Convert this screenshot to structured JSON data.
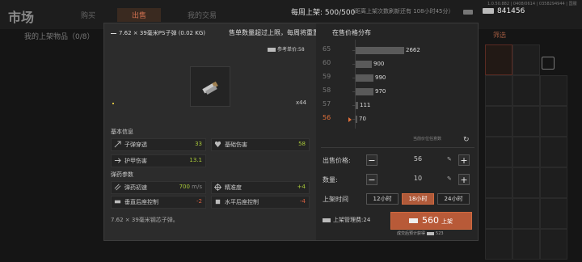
{
  "background": {
    "title": "市场",
    "tabs": [
      "购买",
      "出售",
      "我的交易"
    ],
    "listing_limit_label": "每周上架:",
    "listing_limit_value": "500/500",
    "listing_limit_note": "（距离上架次数刷新还有 108小时45分）",
    "debug_text": "1.0.50.882 | 0408/0614 | 0358294944 | 国服",
    "money": "841456",
    "my_listings": "我的上架物品（0/8）",
    "right_button": "筛选"
  },
  "item": {
    "name": "7.62 × 39毫米PS子弹 (0.02 KG)",
    "reference_label": "参考单价:",
    "reference_price": "58",
    "quantity": "x44",
    "description": "7.62 × 39毫米钢芯子弹。"
  },
  "warning": "售单数量超过上限，每周将重置售单上限",
  "basic_info_title": "基本信息",
  "basic_stats": [
    {
      "label": "子弹穿透",
      "value": "33",
      "icon": "penetration-icon"
    },
    {
      "label": "基础伤害",
      "value": "58",
      "icon": "damage-icon"
    },
    {
      "label": "护甲伤害",
      "value": "13.1",
      "icon": "armor-damage-icon"
    }
  ],
  "ammo_params_title": "弹药参数",
  "ammo_stats": [
    {
      "label": "弹药初速",
      "value": "700",
      "unit": "m/s",
      "icon": "velocity-icon"
    },
    {
      "label": "精准度",
      "value": "+4",
      "icon": "accuracy-icon"
    },
    {
      "label": "垂直后座控制",
      "value": "-2",
      "icon": "vertical-recoil-icon"
    },
    {
      "label": "水平后座控制",
      "value": "-4",
      "icon": "horizontal-recoil-icon"
    }
  ],
  "chart_data": {
    "type": "bar",
    "title": "在售价格分布",
    "orientation": "horizontal",
    "categories": [
      "65",
      "60",
      "59",
      "58",
      "57",
      "56"
    ],
    "values": [
      2662,
      900,
      990,
      970,
      111,
      70
    ],
    "current_price_category": "56",
    "ylabel": "",
    "xlabel": ""
  },
  "chart_hint": "当前价位任意数",
  "sell_price_label": "出售价格:",
  "sell_price": "56",
  "quantity_label": "数量:",
  "quantity": "10",
  "duration_label": "上架时间",
  "durations": [
    "12小时",
    "18小时",
    "24小时"
  ],
  "selected_duration": "18小时",
  "fee_label": "上架管理费:",
  "fee": "24",
  "list_amount": "560",
  "list_label": "上架",
  "estimated_label": "成交后预计获得",
  "estimated": "523",
  "colors": {
    "accent": "#b85a38",
    "positive": "#a8c838",
    "negative": "#d86040"
  }
}
